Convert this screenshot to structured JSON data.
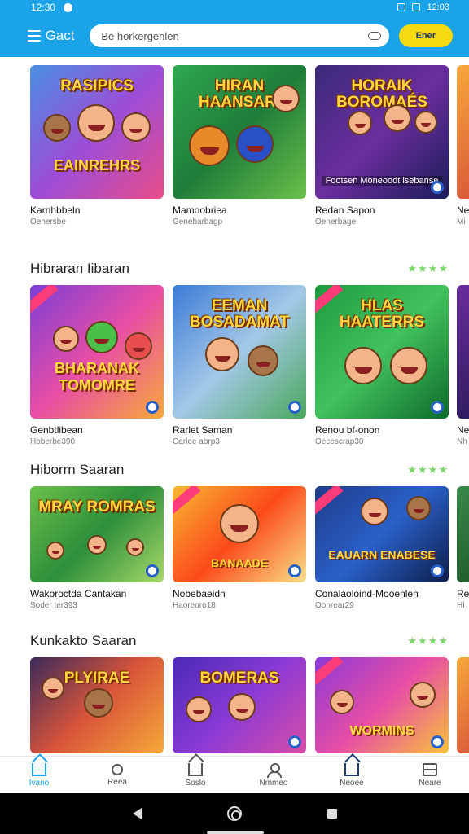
{
  "status_bar": {
    "time": "12:30",
    "right_text": "12:03"
  },
  "app_bar": {
    "brand": "Gact",
    "search_placeholder": "Be horkergenlen",
    "cta_label": "Ener"
  },
  "colors": {
    "primary": "#1aa3e8",
    "cta": "#f6d90f",
    "stars": "#7bd86a"
  },
  "sections": [
    {
      "title": "",
      "cards": [
        {
          "title": "Karnhbbeln",
          "sub": "Oenersbe",
          "art": "RASIPICS",
          "art2": "EAINREHRS",
          "bg": "linear-gradient(135deg,#4a90e2,#9b4dd8,#e84d8a)"
        },
        {
          "title": "Mamoobriea",
          "sub": "Genebarbagp",
          "art": "HIRAN HAANSARI",
          "art2": "",
          "bg": "linear-gradient(135deg,#2fa84f,#1e7d3a,#6cc04a)"
        },
        {
          "title": "Redan Sapon",
          "sub": "Oenerbage",
          "art": "HORAIK BOROMAÉS",
          "art2": "",
          "caption": "Footsen Moneoodt isebanse",
          "bg": "linear-gradient(135deg,#3a2a7a,#6b2e9e,#1d1d5a)"
        }
      ],
      "peek": {
        "title": "Ne",
        "sub": "Mi"
      }
    },
    {
      "title": "Hibraran Iibaran",
      "stars": "★★★★",
      "cards": [
        {
          "title": "Genbtlibean",
          "sub": "Hoberbe390",
          "art": "",
          "art2": "BHARANAK TOMOMRE",
          "bg": "linear-gradient(135deg,#7b3fd6,#e84da6,#f7a93a)"
        },
        {
          "title": "Rarlet Saman",
          "sub": "Carlee abrp3",
          "art": "EEMAN BOSADAMAT",
          "art2": "",
          "bg": "linear-gradient(135deg,#3b7bd6,#a3c8e8,#4aa85a)"
        },
        {
          "title": "Renou bf-onon",
          "sub": "Oecescrap30",
          "art": "HLAS HAATERRS",
          "art2": "",
          "bg": "linear-gradient(135deg,#1f9a3e,#42c15d,#0d6b2a)"
        }
      ],
      "peek": {
        "title": "Ne",
        "sub": "Nh"
      }
    },
    {
      "title": "Hiborrn Saaran",
      "stars": "★★★★",
      "cards": [
        {
          "title": "Wakoroctda Cantakan",
          "sub": "Soder ter393",
          "art": "MRAY ROMRAS",
          "art2": "",
          "bg": "linear-gradient(135deg,#6cc04a,#2c8f3a,#a8d86a)"
        },
        {
          "title": "Nobebaeidn",
          "sub": "Haoreoro18",
          "art": "",
          "art2": "BANAADE",
          "bg": "linear-gradient(135deg,#f7b733,#fc4a1a,#f7e08a)"
        },
        {
          "title": "Conalaoloind-Mooenlen",
          "sub": "Oonrear29",
          "art": "",
          "art2": "EAUARN ENABESE",
          "bg": "linear-gradient(135deg,#1e3c8a,#2a60c8,#0e1e4a)"
        }
      ],
      "peek": {
        "title": "Re",
        "sub": "Hl"
      }
    },
    {
      "title": "Kunkakto Saaran",
      "stars": "★★★★",
      "cards": [
        {
          "title": "",
          "sub": "",
          "art": "PLYIRAE",
          "art2": "",
          "bg": "linear-gradient(135deg,#3a2a5a,#d8543a,#f7a93a)"
        },
        {
          "title": "",
          "sub": "",
          "art": "BOMERAS",
          "art2": "",
          "bg": "linear-gradient(135deg,#4a2ab8,#8a3ad6,#d84da6)"
        },
        {
          "title": "",
          "sub": "",
          "art": "",
          "art2": "WORMINS",
          "bg": "linear-gradient(135deg,#8a3ad6,#e84da6,#f7c23a)"
        }
      ],
      "peek": {
        "title": "",
        "sub": ""
      }
    }
  ],
  "bottom_nav": [
    {
      "label": "Ivano",
      "icon": "home-icon",
      "active": true
    },
    {
      "label": "Reea",
      "icon": "search-icon",
      "active": false
    },
    {
      "label": "Soslo",
      "icon": "home-outline-icon",
      "active": false
    },
    {
      "label": "Nmmeo",
      "icon": "person-icon",
      "active": false
    },
    {
      "label": "Neoee",
      "icon": "house-icon",
      "active": false
    },
    {
      "label": "Neare",
      "icon": "grid-icon",
      "active": false
    }
  ]
}
